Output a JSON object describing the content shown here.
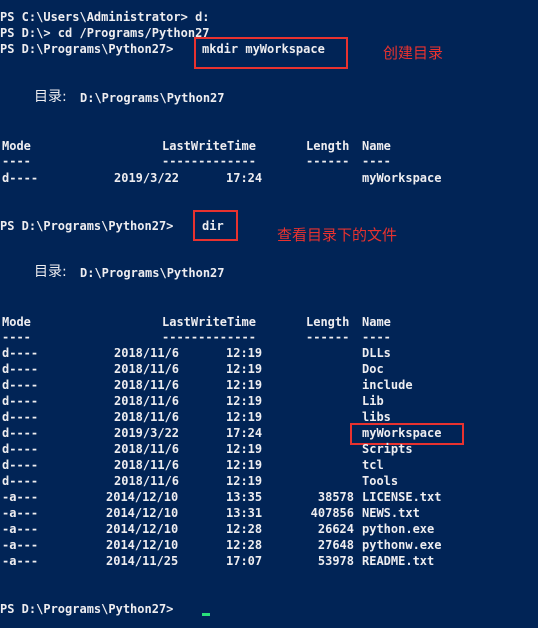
{
  "commands": {
    "line1": "PS C:\\Users\\Administrator> d:",
    "line2": "PS D:\\> cd /Programs/Python27",
    "line3_prompt": "PS D:\\Programs\\Python27>",
    "line3_cmd": "mkdir myWorkspace",
    "dir_prompt": "PS D:\\Programs\\Python27>",
    "dir_cmd": "dir",
    "final_prompt": "PS D:\\Programs\\Python27>"
  },
  "listing1": {
    "dir_label": "目录:",
    "dir_path": "D:\\Programs\\Python27",
    "headers": {
      "mode": "Mode",
      "time": "LastWriteTime",
      "length": "Length",
      "name": "Name"
    },
    "underlines": {
      "mode": "----",
      "time": "-------------",
      "length": "------",
      "name": "----"
    },
    "rows": [
      {
        "mode": "d----",
        "date": "2019/3/22",
        "time": "17:24",
        "length": "",
        "name": "myWorkspace"
      }
    ]
  },
  "listing2": {
    "dir_label": "目录:",
    "dir_path": "D:\\Programs\\Python27",
    "headers": {
      "mode": "Mode",
      "time": "LastWriteTime",
      "length": "Length",
      "name": "Name"
    },
    "underlines": {
      "mode": "----",
      "time": "-------------",
      "length": "------",
      "name": "----"
    },
    "rows": [
      {
        "mode": "d----",
        "date": "2018/11/6",
        "time": "12:19",
        "length": "",
        "name": "DLLs"
      },
      {
        "mode": "d----",
        "date": "2018/11/6",
        "time": "12:19",
        "length": "",
        "name": "Doc"
      },
      {
        "mode": "d----",
        "date": "2018/11/6",
        "time": "12:19",
        "length": "",
        "name": "include"
      },
      {
        "mode": "d----",
        "date": "2018/11/6",
        "time": "12:19",
        "length": "",
        "name": "Lib"
      },
      {
        "mode": "d----",
        "date": "2018/11/6",
        "time": "12:19",
        "length": "",
        "name": "libs"
      },
      {
        "mode": "d----",
        "date": "2019/3/22",
        "time": "17:24",
        "length": "",
        "name": "myWorkspace"
      },
      {
        "mode": "d----",
        "date": "2018/11/6",
        "time": "12:19",
        "length": "",
        "name": "Scripts"
      },
      {
        "mode": "d----",
        "date": "2018/11/6",
        "time": "12:19",
        "length": "",
        "name": "tcl"
      },
      {
        "mode": "d----",
        "date": "2018/11/6",
        "time": "12:19",
        "length": "",
        "name": "Tools"
      },
      {
        "mode": "-a---",
        "date": "2014/12/10",
        "time": "13:35",
        "length": "38578",
        "name": "LICENSE.txt"
      },
      {
        "mode": "-a---",
        "date": "2014/12/10",
        "time": "13:31",
        "length": "407856",
        "name": "NEWS.txt"
      },
      {
        "mode": "-a---",
        "date": "2014/12/10",
        "time": "12:28",
        "length": "26624",
        "name": "python.exe"
      },
      {
        "mode": "-a---",
        "date": "2014/12/10",
        "time": "12:28",
        "length": "27648",
        "name": "pythonw.exe"
      },
      {
        "mode": "-a---",
        "date": "2014/11/25",
        "time": "17:07",
        "length": "53978",
        "name": "README.txt"
      }
    ]
  },
  "annotations": {
    "mkdir_note": "创建目录",
    "dir_note": "查看目录下的文件"
  },
  "colors": {
    "background": "#012456",
    "text": "#eeedf0",
    "annotation": "#e8322f",
    "cursor": "#29e07a"
  }
}
